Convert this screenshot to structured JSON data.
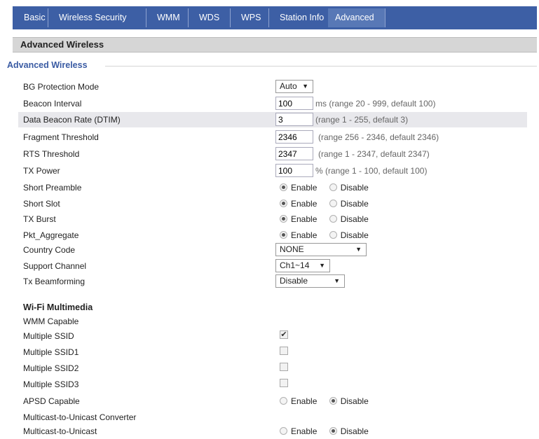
{
  "tabs": [
    "Basic",
    "Wireless Security",
    "WMM",
    "WDS",
    "WPS",
    "Station Info",
    "Advanced"
  ],
  "active_tab": "Advanced",
  "section_title": "Advanced Wireless",
  "group_title": "Advanced Wireless",
  "fields": {
    "bg_protection": {
      "label": "BG Protection Mode",
      "value": "Auto"
    },
    "beacon_interval": {
      "label": "Beacon Interval",
      "value": "100",
      "hint": "ms (range 20 - 999, default 100)"
    },
    "dtim": {
      "label": "Data Beacon Rate (DTIM)",
      "value": "3",
      "hint": "(range 1 - 255, default 3)"
    },
    "fragment": {
      "label": "Fragment Threshold",
      "value": "2346",
      "hint": "(range 256 - 2346, default 2346)"
    },
    "rts": {
      "label": "RTS Threshold",
      "value": "2347",
      "hint": "(range 1 - 2347, default 2347)"
    },
    "tx_power": {
      "label": "TX Power",
      "value": "100",
      "hint": "% (range 1 - 100, default 100)"
    },
    "short_preamble": {
      "label": "Short Preamble",
      "selected": "Enable"
    },
    "short_slot": {
      "label": "Short Slot",
      "selected": "Enable"
    },
    "tx_burst": {
      "label": "TX Burst",
      "selected": "Enable"
    },
    "pkt_aggregate": {
      "label": "Pkt_Aggregate",
      "selected": "Enable"
    },
    "country_code": {
      "label": "Country Code",
      "value": "NONE"
    },
    "support_channel": {
      "label": "Support Channel",
      "value": "Ch1~14"
    },
    "tx_beamforming": {
      "label": "Tx Beamforming",
      "value": "Disable"
    }
  },
  "radio_labels": {
    "enable": "Enable",
    "disable": "Disable"
  },
  "wifi_multimedia": {
    "title": "Wi-Fi Multimedia",
    "wmm_capable": "WMM Capable",
    "multiple_ssid": {
      "label": "Multiple SSID",
      "checked": true
    },
    "multiple_ssid1": {
      "label": "Multiple SSID1",
      "checked": false
    },
    "multiple_ssid2": {
      "label": "Multiple SSID2",
      "checked": false
    },
    "multiple_ssid3": {
      "label": "Multiple SSID3",
      "checked": false
    },
    "apsd_capable": {
      "label": "APSD Capable",
      "selected": "Disable"
    }
  },
  "multicast": {
    "title": "Multicast-to-Unicast Converter",
    "item": {
      "label": "Multicast-to-Unicast",
      "selected": "Disable"
    }
  },
  "colors": {
    "tab_bar": "#3d5fa5",
    "active_tab": "#5878b6",
    "group_title": "#3a5ba3",
    "header_bg": "#d6d6d6"
  }
}
